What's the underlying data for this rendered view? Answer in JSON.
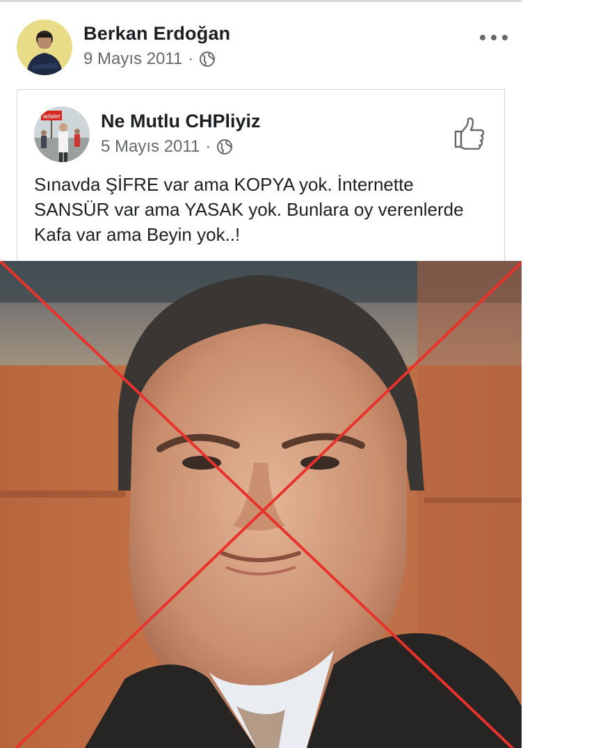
{
  "post": {
    "author_name": "Berkan Erdoğan",
    "date": "9 Mayıs 2011",
    "separator": "·",
    "privacy_icon": "globe-icon",
    "more_icon": "more-options-icon"
  },
  "shared": {
    "page_name": "Ne Mutlu CHPliyiz",
    "date": "5 Mayıs 2011",
    "separator": "·",
    "privacy_icon": "globe-icon",
    "like_icon": "thumbs-up-icon",
    "avatar_sign_text": "adalet",
    "text": "Sınavda ŞİFRE var ama KOPYA yok. İnternette SANSÜR var ama YASAK yok. Bunlara oy verenlerde Kafa var ama Beyin yok..!"
  },
  "colors": {
    "name": "#1c1e21",
    "meta": "#65676b",
    "border": "#d3d5d9",
    "cross": "#e8322b",
    "background": "#ffffff"
  }
}
